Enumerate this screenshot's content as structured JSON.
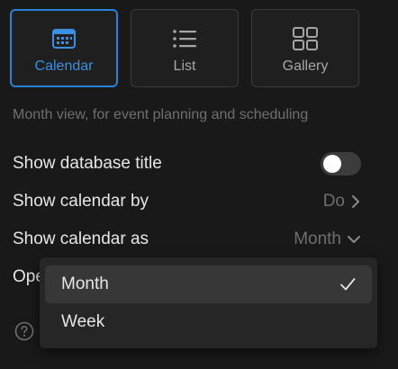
{
  "layouts": [
    {
      "label": "Calendar",
      "icon": "calendar-icon",
      "selected": true
    },
    {
      "label": "List",
      "icon": "list-icon",
      "selected": false
    },
    {
      "label": "Gallery",
      "icon": "gallery-icon",
      "selected": false
    }
  ],
  "description": "Month view, for event planning and scheduling",
  "settings": {
    "show_database_title": {
      "label": "Show database title",
      "toggle_on": false
    },
    "show_calendar_by": {
      "label": "Show calendar by",
      "value": "Do"
    },
    "show_calendar_as": {
      "label": "Show calendar as",
      "value": "Month"
    },
    "open_pages_in": {
      "label": "Ope"
    }
  },
  "dropdown": {
    "options": [
      {
        "label": "Month",
        "selected": true
      },
      {
        "label": "Week",
        "selected": false
      }
    ]
  },
  "colors": {
    "accent": "#2a82d8",
    "background": "#191919",
    "menu_background": "#262626"
  }
}
